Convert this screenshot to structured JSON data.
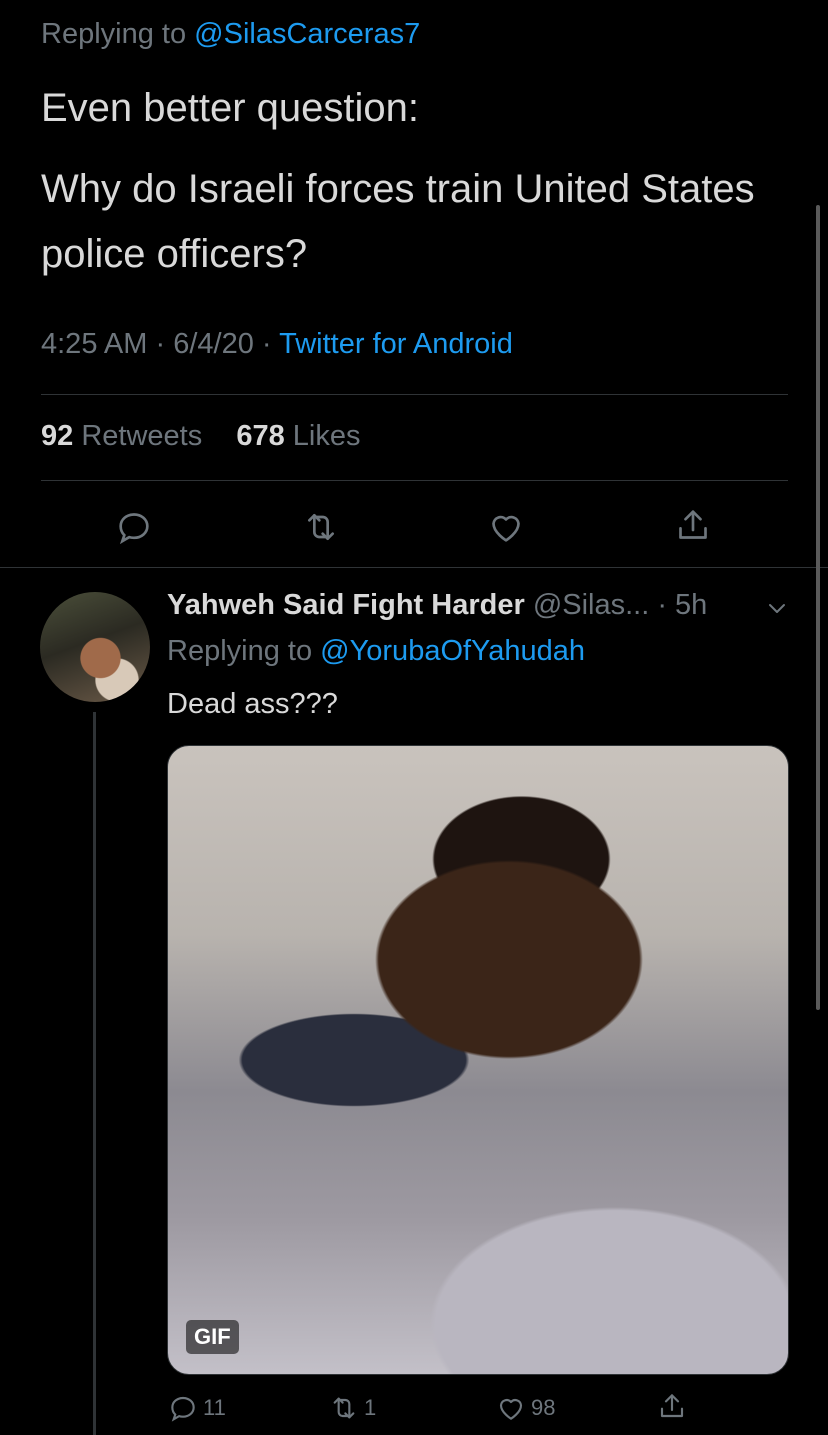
{
  "main_tweet": {
    "replying_to_label": "Replying to",
    "replying_to_handle": "@SilasCarceras7",
    "paragraphs": [
      "Even better question:",
      "Why do Israeli forces train United States police officers?"
    ],
    "time": "4:25 AM",
    "date": "6/4/20",
    "separator": "·",
    "source": "Twitter for Android",
    "retweets_count": "92",
    "retweets_label": "Retweets",
    "likes_count": "678",
    "likes_label": "Likes"
  },
  "reply_tweet": {
    "display_name": "Yahweh Said Fight Harder",
    "handle": "@Silas...",
    "time": "· 5h",
    "replying_to_label": "Replying to",
    "replying_to_handle": "@YorubaOfYahudah",
    "text": "Dead ass???",
    "media_badge": "GIF",
    "reply_count": "11",
    "retweet_count": "1",
    "like_count": "98"
  },
  "colors": {
    "background": "#000000",
    "text": "#d9d9d9",
    "secondary": "#6e767d",
    "accent": "#1d9bf0",
    "divider": "#2f3336"
  },
  "icons": [
    "reply-icon",
    "retweet-icon",
    "like-icon",
    "share-icon",
    "chevron-down-icon"
  ]
}
